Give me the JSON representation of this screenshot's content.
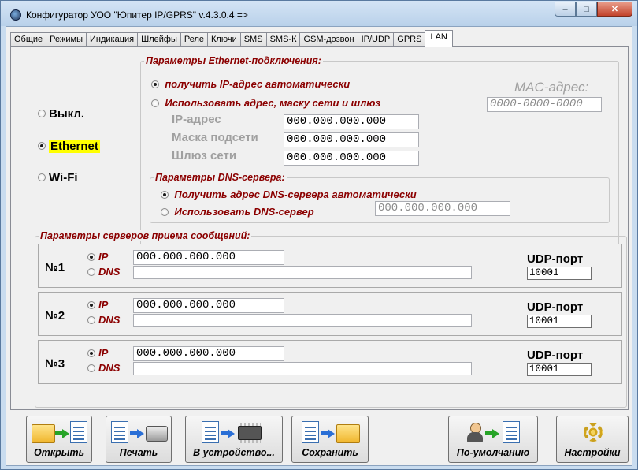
{
  "window": {
    "title": "Конфигуратор УОО \"Юпитер IP/GPRS\" v.4.3.0.4  =>",
    "controls": [
      "minimize",
      "maximize",
      "close"
    ]
  },
  "tabs": [
    {
      "label": "Общие"
    },
    {
      "label": "Режимы"
    },
    {
      "label": "Индикация"
    },
    {
      "label": "Шлейфы"
    },
    {
      "label": "Реле"
    },
    {
      "label": "Ключи"
    },
    {
      "label": "SMS"
    },
    {
      "label": "SMS-К"
    },
    {
      "label": "GSM-дозвон"
    },
    {
      "label": "IP/UDP"
    },
    {
      "label": "GPRS"
    },
    {
      "label": "LAN",
      "active": true
    }
  ],
  "mode": {
    "options": [
      {
        "label": "Выкл.",
        "selected": false
      },
      {
        "label": "Ethernet",
        "selected": true
      },
      {
        "label": "Wi-Fi",
        "selected": false
      }
    ]
  },
  "ethernet": {
    "legend": "Параметры Ethernet-подключения:",
    "auto_label": "получить IP-адрес автоматически",
    "manual_label": "Использовать адрес, маску сети и шлюз",
    "mac_label": "MAC-адрес:",
    "mac_value": "0000-0000-0000",
    "ip_label": "IP-адрес",
    "ip_value": "000.000.000.000",
    "mask_label": "Маска подсети",
    "mask_value": "000.000.000.000",
    "gateway_label": "Шлюз сети",
    "gateway_value": "000.000.000.000"
  },
  "dns": {
    "legend": "Параметры DNS-сервера:",
    "auto_label": "Получить адрес DNS-сервера автоматически",
    "manual_label": "Использовать DNS-сервер",
    "server_value": "000.000.000.000"
  },
  "servers": {
    "legend": "Параметры серверов приема сообщений:",
    "ip_label": "IP",
    "dns_label": "DNS",
    "udp_label": "UDP-порт",
    "items": [
      {
        "num": "№1",
        "ip": "000.000.000.000",
        "dns": "",
        "port": "10001"
      },
      {
        "num": "№2",
        "ip": "000.000.000.000",
        "dns": "",
        "port": "10001"
      },
      {
        "num": "№3",
        "ip": "000.000.000.000",
        "dns": "",
        "port": "10001"
      }
    ]
  },
  "toolbar": {
    "open": "Открыть",
    "print": "Печать",
    "to_device": "В устройство...",
    "save": "Сохранить",
    "defaults": "По-умолчанию",
    "settings": "Настройки"
  }
}
